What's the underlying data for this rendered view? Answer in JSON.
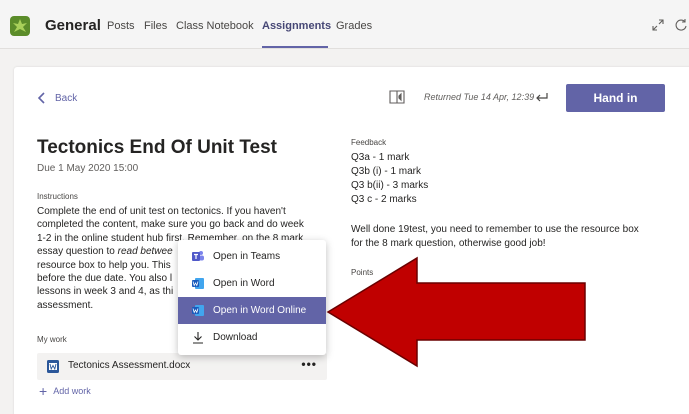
{
  "header": {
    "team_name": "General",
    "tabs": [
      {
        "label": "Posts",
        "active": false
      },
      {
        "label": "Files",
        "active": false
      },
      {
        "label": "Class Notebook",
        "active": false
      },
      {
        "label": "Assignments",
        "active": true
      },
      {
        "label": "Grades",
        "active": false
      }
    ],
    "icons": [
      "team-avatar-icon",
      "expand-icon",
      "refresh-icon"
    ]
  },
  "toolbar": {
    "back_label": "Back",
    "returned_text": "Returned Tue 14 Apr, 12:39",
    "hand_in_label": "Hand in"
  },
  "assignment": {
    "title": "Tectonics End Of Unit Test",
    "due": "Due 1 May 2020 15:00",
    "instructions_label": "Instructions",
    "instructions": {
      "line1": "Complete the end of unit test on tectonics. If you haven't",
      "line2": "completed the content, make sure you go back and do week",
      "line3": "1-2 in the online student hub first. Remember, on the 8 mark",
      "line4a": "essay question to ",
      "line4b": "read betwee",
      "line5": "resource box to help you. This",
      "line6": "before the due date. You also l",
      "line7": "lessons in week 3 and 4, as thi",
      "line8": "assessment."
    },
    "my_work_label": "My work",
    "file_name": "Tectonics Assessment.docx",
    "more_label": "•••",
    "add_work_label": "Add work"
  },
  "feedback": {
    "label": "Feedback",
    "lines": [
      "Q3a - 1 mark",
      "Q3b (i) - 1 mark",
      "Q3 b(ii) - 3 marks",
      "Q3 c - 2 marks"
    ],
    "comment_line1": "Well done 19test, you need to remember to use the resource box",
    "comment_line2": "for the 8 mark question, otherwise good job!",
    "points_label": "Points"
  },
  "context_menu": {
    "items": [
      {
        "label": "Open in Teams",
        "icon": "teams-icon",
        "selected": false
      },
      {
        "label": "Open in Word",
        "icon": "word-icon",
        "selected": false
      },
      {
        "label": "Open in Word Online",
        "icon": "word-online-icon",
        "selected": true
      },
      {
        "label": "Download",
        "icon": "download-icon",
        "selected": false
      }
    ]
  },
  "colors": {
    "accent": "#6264a7",
    "annotation_arrow": "#c00000"
  }
}
